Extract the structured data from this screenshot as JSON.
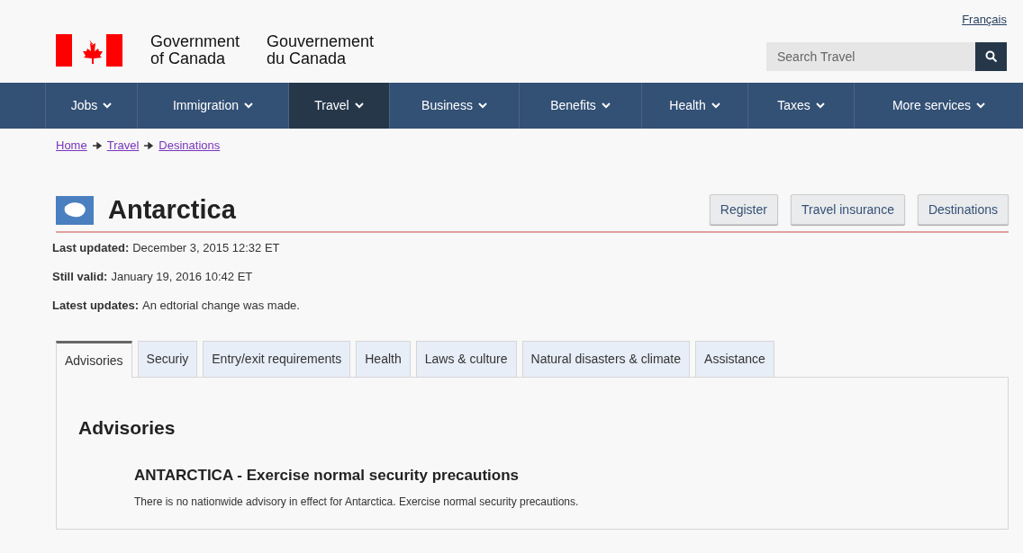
{
  "language_link": "Français",
  "brand": {
    "line_en_1": "Government",
    "line_en_2": "of Canada",
    "line_fr_1": "Gouvernement",
    "line_fr_2": "du Canada"
  },
  "search": {
    "placeholder": "Search Travel"
  },
  "nav": [
    {
      "label": "Jobs",
      "selected": false
    },
    {
      "label": "Immigration",
      "selected": false
    },
    {
      "label": "Travel",
      "selected": true
    },
    {
      "label": "Business",
      "selected": false
    },
    {
      "label": "Benefits",
      "selected": false
    },
    {
      "label": "Health",
      "selected": false
    },
    {
      "label": "Taxes",
      "selected": false
    },
    {
      "label": "More services",
      "selected": false
    }
  ],
  "breadcrumb": [
    "Home",
    "Travel",
    "Desinations"
  ],
  "title": "Antarctica",
  "actions": [
    "Register",
    "Travel insurance",
    "Destinations"
  ],
  "meta": [
    {
      "label": "Last updated:",
      "value": "December 3, 2015 12:32 ET"
    },
    {
      "label": "Still valid:",
      "value": "January 19, 2016 10:42 ET"
    },
    {
      "label": "Latest updates:",
      "value": "An edtorial change was made."
    }
  ],
  "tabs": [
    {
      "label": "Advisories",
      "selected": true
    },
    {
      "label": "Securiy",
      "selected": false
    },
    {
      "label": "Entry/exit requirements",
      "selected": false
    },
    {
      "label": "Health",
      "selected": false
    },
    {
      "label": "Laws & culture",
      "selected": false
    },
    {
      "label": "Natural disasters & climate",
      "selected": false
    },
    {
      "label": "Assistance",
      "selected": false
    }
  ],
  "panel": {
    "heading": "Advisories",
    "subheading": "ANTARCTICA - Exercise normal security precautions",
    "text": "There is no nationwide advisory in effect for Antarctica. Exercise normal security precautions."
  }
}
